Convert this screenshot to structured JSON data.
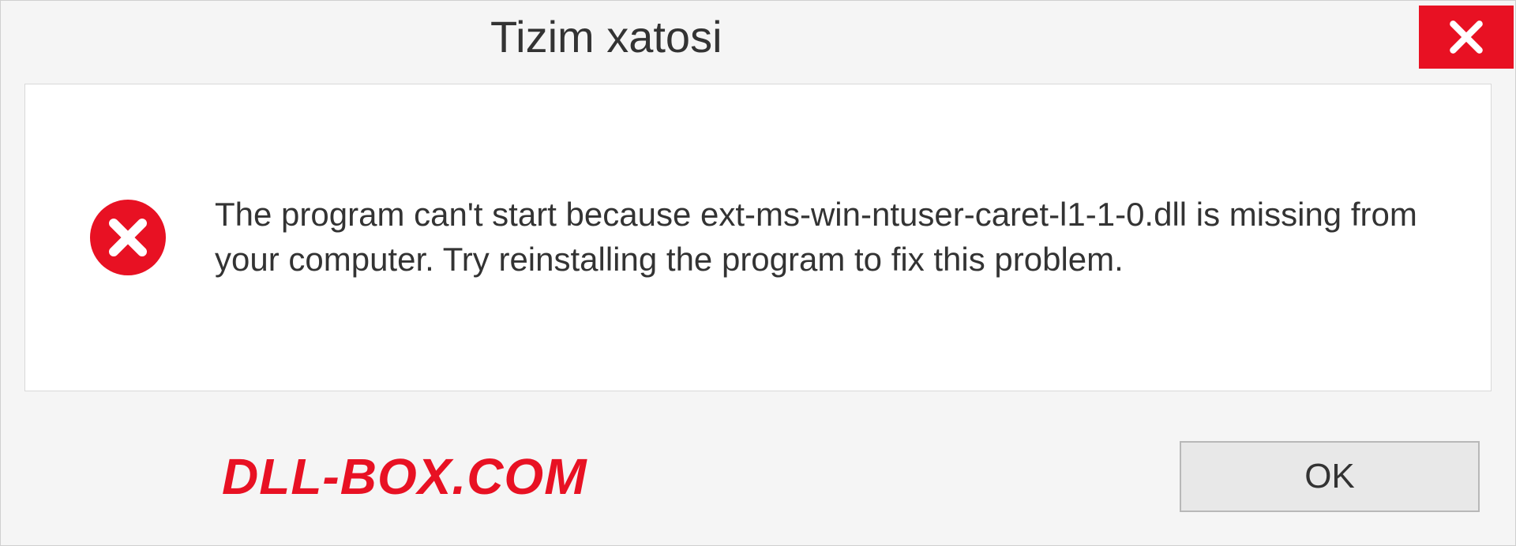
{
  "titlebar": {
    "title": "Tizim xatosi"
  },
  "content": {
    "message": "The program can't start because ext-ms-win-ntuser-caret-l1-1-0.dll is missing from your computer. Try reinstalling the program to fix this problem."
  },
  "footer": {
    "watermark": "DLL-BOX.COM",
    "ok_label": "OK"
  }
}
